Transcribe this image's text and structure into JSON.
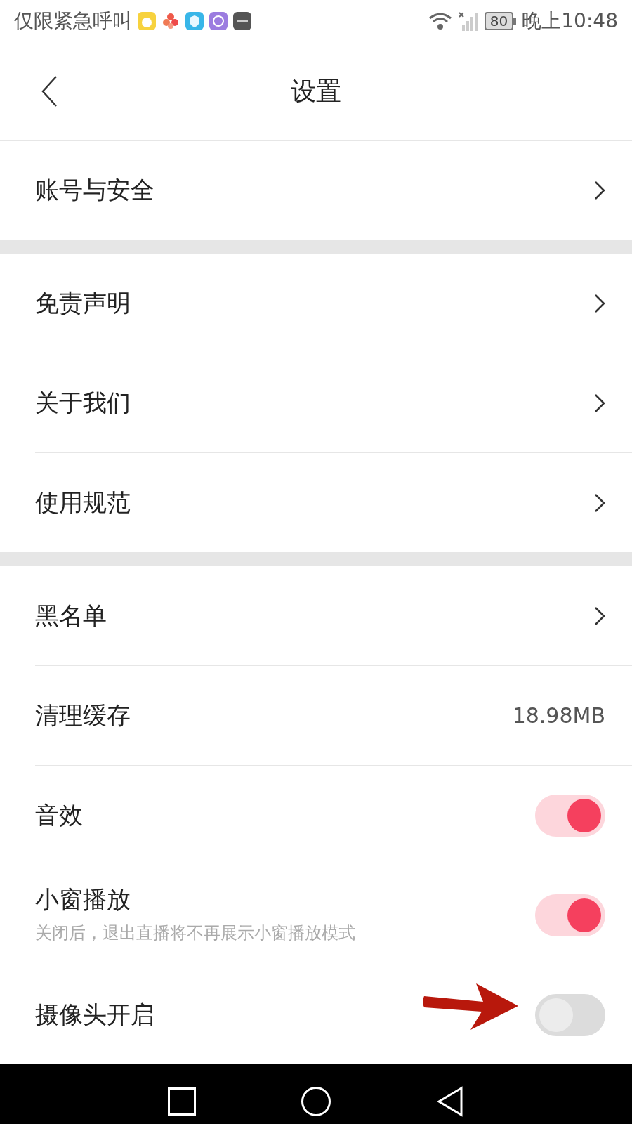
{
  "status_bar": {
    "carrier": "仅限紧急呼叫",
    "battery": "80",
    "time": "晚上10:48"
  },
  "header": {
    "title": "设置"
  },
  "sections": [
    {
      "items": [
        {
          "kind": "link",
          "label": "账号与安全"
        }
      ]
    },
    {
      "items": [
        {
          "kind": "link",
          "label": "免责声明"
        },
        {
          "kind": "link",
          "label": "关于我们"
        },
        {
          "kind": "link",
          "label": "使用规范"
        }
      ]
    },
    {
      "items": [
        {
          "kind": "link",
          "label": "黑名单"
        },
        {
          "kind": "value",
          "label": "清理缓存",
          "value": "18.98MB"
        },
        {
          "kind": "toggle",
          "label": "音效",
          "on": true
        },
        {
          "kind": "toggle",
          "label": "小窗播放",
          "subtitle": "关闭后，退出直播将不再展示小窗播放模式",
          "on": true
        },
        {
          "kind": "toggle",
          "label": "摄像头开启",
          "on": false,
          "annotated": true
        }
      ]
    }
  ]
}
